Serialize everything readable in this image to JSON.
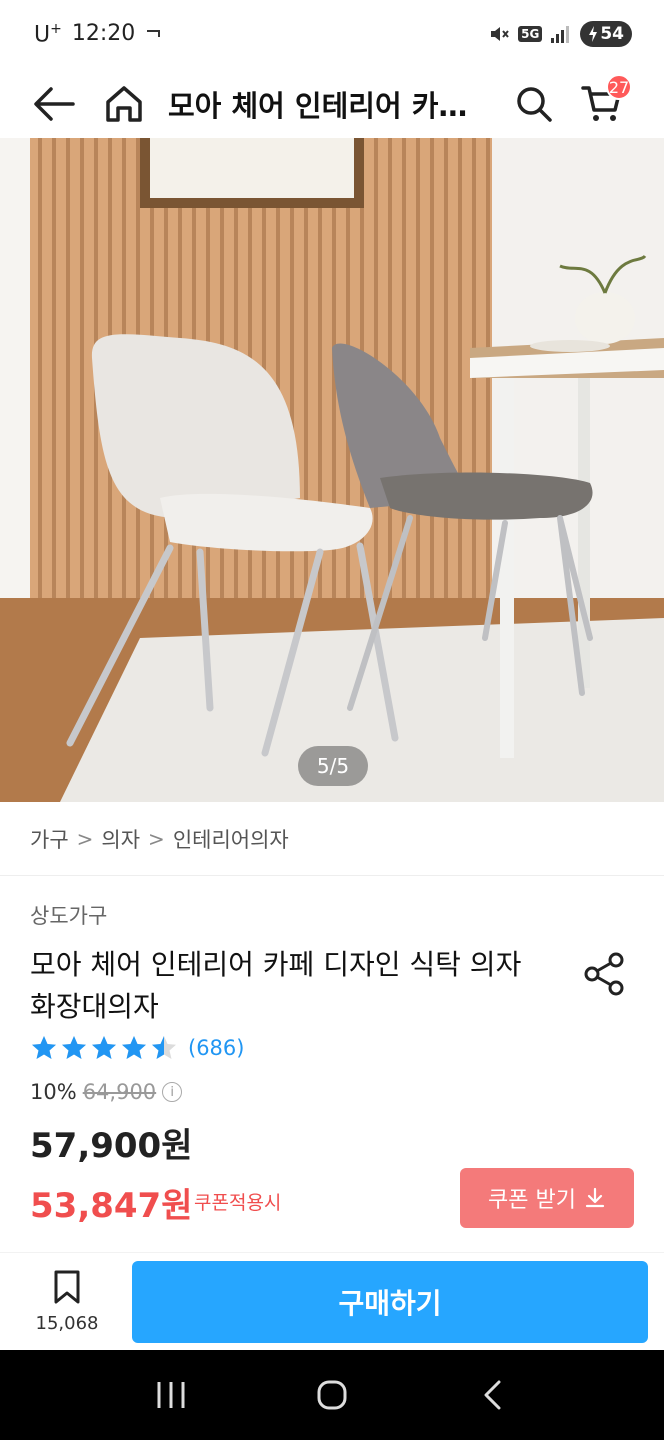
{
  "status_bar": {
    "carrier": "U",
    "carrier_sup": "+",
    "time": "12:20",
    "network": "5G",
    "battery": "54"
  },
  "app_bar": {
    "title": "모아 체어 인테리어 카페 디자인 식탁 의자 화장대의자",
    "cart_count": "27"
  },
  "gallery": {
    "pager": "5/5"
  },
  "breadcrumb": {
    "items": [
      "가구",
      "의자",
      "인테리어의자"
    ],
    "separator": ">"
  },
  "product": {
    "brand": "상도가구",
    "title": "모아 체어 인테리어 카페 디자인 식탁 의자 화장대의자",
    "rating": 4.5,
    "rating_max": 5,
    "review_count": "(686)",
    "discount_rate": "10%",
    "original_price": "64,900",
    "info_symbol": "i",
    "sale_price": "57,900원",
    "coupon_price": "53,847원",
    "coupon_note": "쿠폰적용시",
    "coupon_button": "쿠폰 받기"
  },
  "bottom_bar": {
    "bookmark_count": "15,068",
    "buy_label": "구매하기"
  },
  "colors": {
    "accent_blue": "#26a6ff",
    "coupon_red": "#f04e4e",
    "coupon_btn": "#f47a7a",
    "star_blue": "#2196f3",
    "badge_red": "#ff5a5a"
  },
  "icons": [
    "back-arrow-icon",
    "home-icon",
    "search-icon",
    "cart-icon",
    "share-icon",
    "star-icon",
    "info-icon",
    "download-icon",
    "bookmark-icon",
    "recent-apps-icon",
    "home-nav-icon",
    "back-nav-icon",
    "mute-icon",
    "signal-icon"
  ]
}
